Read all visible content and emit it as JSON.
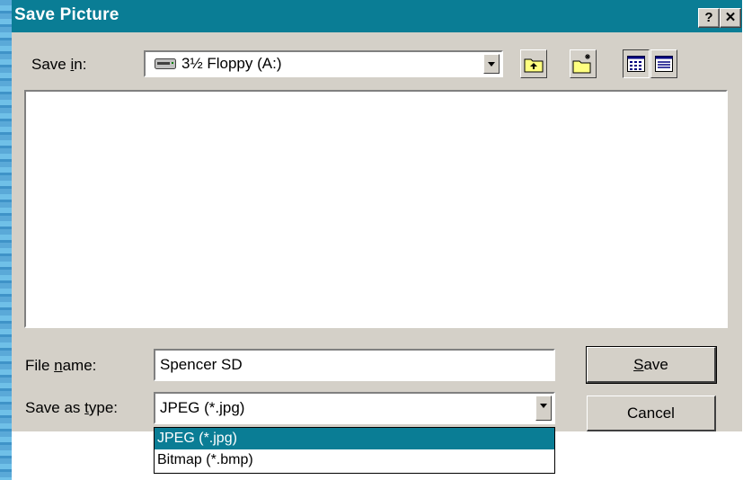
{
  "window": {
    "title": "Save Picture",
    "help_button": "?",
    "close_button": "✕"
  },
  "save_in": {
    "label_pre": "Save ",
    "label_accel": "i",
    "label_post": "n:",
    "value": "3½ Floppy (A:)",
    "icon": "floppy-drive-icon"
  },
  "toolbar": {
    "icons": [
      "up-one-level-icon",
      "new-folder-icon",
      "list-view-icon",
      "details-view-icon"
    ]
  },
  "file_name": {
    "label_pre": "File ",
    "label_accel": "n",
    "label_post": "ame:",
    "value": "Spencer SD"
  },
  "save_as_type": {
    "label_pre": "Save as ",
    "label_accel": "t",
    "label_post": "ype:",
    "value": "JPEG (*.jpg)",
    "options": [
      "JPEG (*.jpg)",
      "Bitmap (*.bmp)"
    ],
    "selected_index": 0
  },
  "buttons": {
    "save_accel": "S",
    "save_rest": "ave",
    "cancel": "Cancel"
  },
  "colors": {
    "titlebar": "#0a7d95",
    "selection": "#0a7d95",
    "face": "#d4d0c8"
  }
}
